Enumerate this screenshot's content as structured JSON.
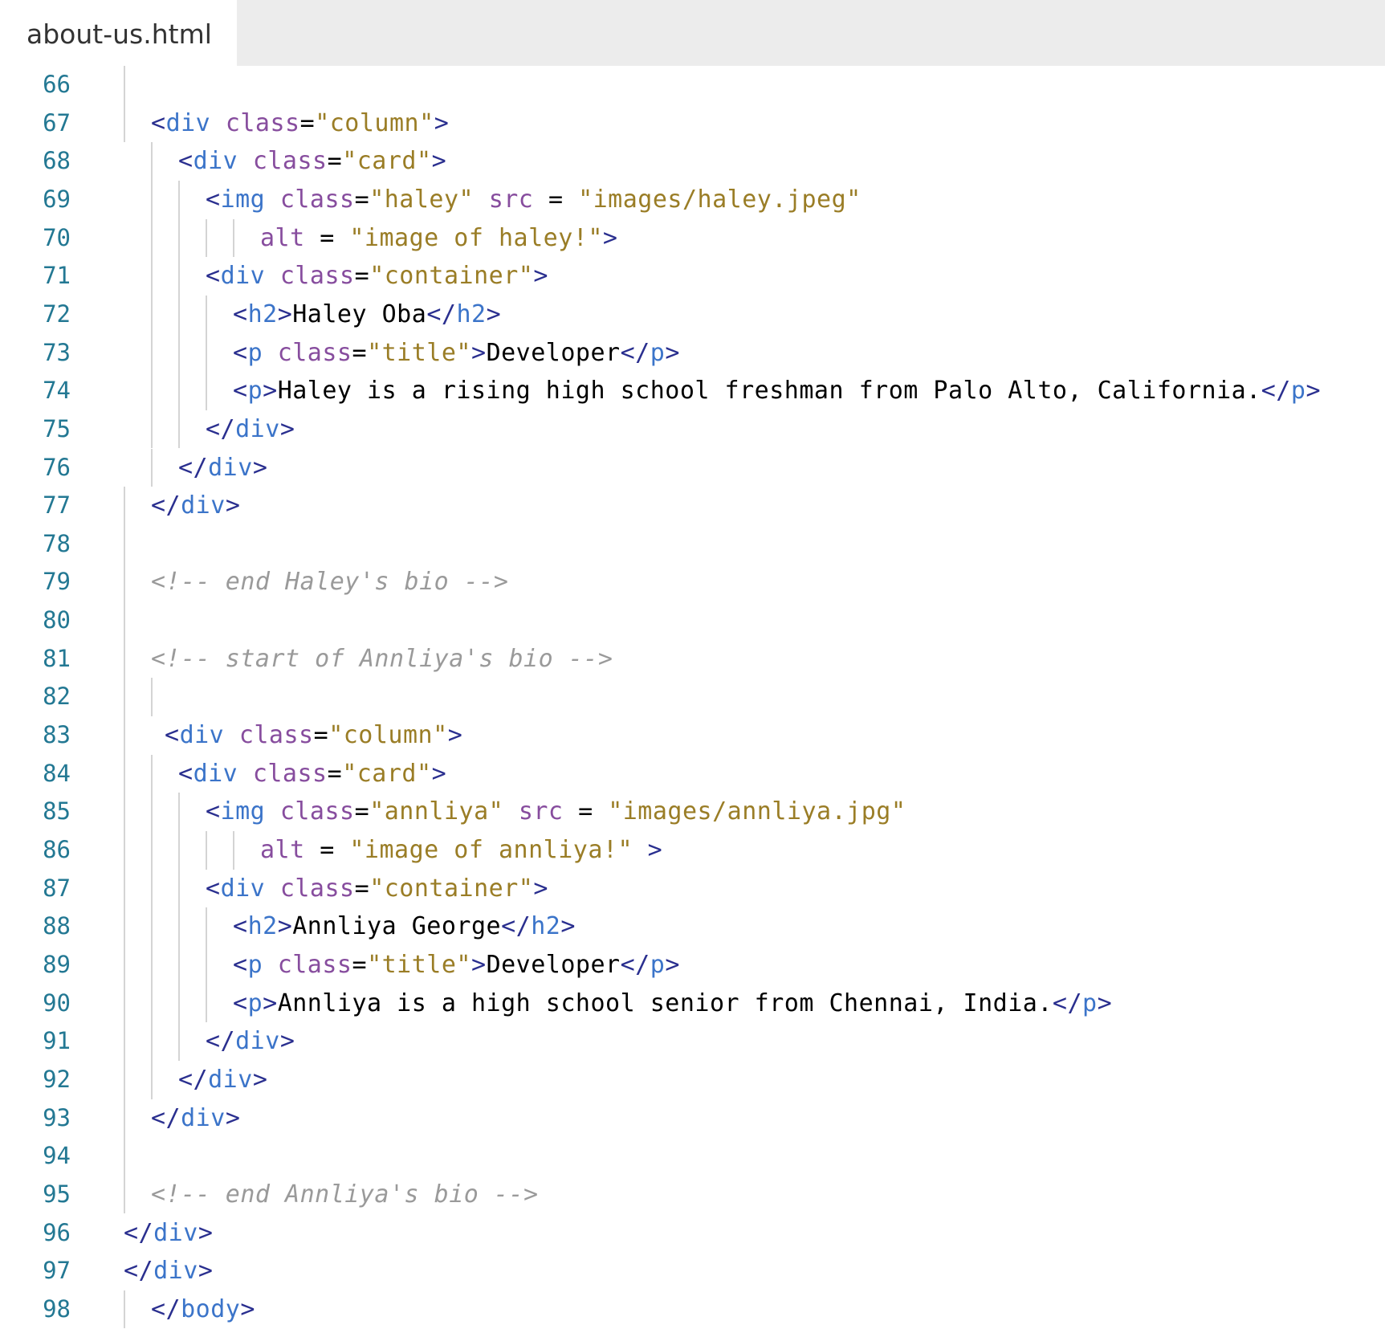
{
  "tab": {
    "label": "about-us.html"
  },
  "lines": [
    {
      "num": "66",
      "code": ""
    },
    {
      "num": "67",
      "code": "<div class=\"column\">"
    },
    {
      "num": "68",
      "code": "<div class=\"card\">"
    },
    {
      "num": "69",
      "code": "<img class=\"haley\" src = \"images/haley.jpeg\""
    },
    {
      "num": "70",
      "code": "alt = \"image of haley!\">"
    },
    {
      "num": "71",
      "code": "<div class=\"container\">"
    },
    {
      "num": "72",
      "code": "<h2>Haley Oba</h2>"
    },
    {
      "num": "73",
      "code": "<p class=\"title\">Developer</p>"
    },
    {
      "num": "74",
      "code": "<p>Haley is a rising high school freshman from Palo Alto, California.</p>"
    },
    {
      "num": "75",
      "code": "</div>"
    },
    {
      "num": "76",
      "code": "</div>"
    },
    {
      "num": "77",
      "code": "</div>"
    },
    {
      "num": "78",
      "code": ""
    },
    {
      "num": "79",
      "code": "<!-- end Haley's bio -->"
    },
    {
      "num": "80",
      "code": ""
    },
    {
      "num": "81",
      "code": "<!-- start of Annliya's bio -->"
    },
    {
      "num": "82",
      "code": ""
    },
    {
      "num": "83",
      "code": "<div class=\"column\">"
    },
    {
      "num": "84",
      "code": "<div class=\"card\">"
    },
    {
      "num": "85",
      "code": "<img class=\"annliya\" src = \"images/annliya.jpg\""
    },
    {
      "num": "86",
      "code": "alt = \"image of annliya!\" >"
    },
    {
      "num": "87",
      "code": "<div class=\"container\">"
    },
    {
      "num": "88",
      "code": "<h2>Annliya George</h2>"
    },
    {
      "num": "89",
      "code": "<p class=\"title\">Developer</p>"
    },
    {
      "num": "90",
      "code": "<p>Annliya is a high school senior from Chennai, India.</p>"
    },
    {
      "num": "91",
      "code": "</div>"
    },
    {
      "num": "92",
      "code": "</div>"
    },
    {
      "num": "93",
      "code": "</div>"
    },
    {
      "num": "94",
      "code": ""
    },
    {
      "num": "95",
      "code": "<!-- end Annliya's bio -->"
    },
    {
      "num": "96",
      "code": "</div>"
    },
    {
      "num": "97",
      "code": "</div>"
    },
    {
      "num": "98",
      "code": "</body>"
    }
  ]
}
